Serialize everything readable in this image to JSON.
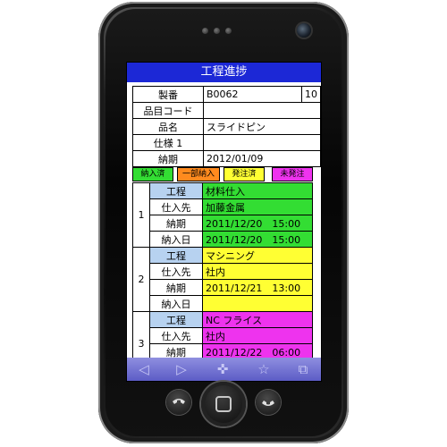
{
  "app": {
    "title": "工程進捗"
  },
  "header": {
    "rows": [
      {
        "label": "製番",
        "value": "B0062",
        "extra": "10"
      },
      {
        "label": "品目コード",
        "value": ""
      },
      {
        "label": "品名",
        "value": "スライドピン"
      },
      {
        "label": "仕様 1",
        "value": ""
      },
      {
        "label": "納期",
        "value": "2012/01/09"
      }
    ]
  },
  "legend": [
    {
      "label": "納入済",
      "color": "#33dd33"
    },
    {
      "label": "一部納入",
      "color": "#ff8a1e"
    },
    {
      "label": "発注済",
      "color": "#ffff33"
    },
    {
      "label": "未発注",
      "color": "#ee33ee"
    }
  ],
  "processes": [
    {
      "index": "1",
      "color": "#33dd33",
      "rows": [
        {
          "label": "工程",
          "value": "材料仕入"
        },
        {
          "label": "仕入先",
          "value": "加藤金属"
        },
        {
          "label": "納期",
          "value": "2011/12/20　15:00"
        },
        {
          "label": "納入日",
          "value": "2011/12/20　15:00"
        }
      ]
    },
    {
      "index": "2",
      "color": "#ffff33",
      "rows": [
        {
          "label": "工程",
          "value": "マシニング"
        },
        {
          "label": "仕入先",
          "value": "社内"
        },
        {
          "label": "納期",
          "value": "2011/12/21　13:00"
        },
        {
          "label": "納入日",
          "value": ""
        }
      ]
    },
    {
      "index": "3",
      "color": "#ee33ee",
      "rows": [
        {
          "label": "工程",
          "value": "NC フライス"
        },
        {
          "label": "仕入先",
          "value": "社内"
        },
        {
          "label": "納期",
          "value": "2011/12/22　06:00"
        }
      ]
    }
  ],
  "navbar": {
    "icons": [
      "back-arrow-icon",
      "forward-arrow-icon",
      "add-icon",
      "star-icon",
      "windows-icon"
    ]
  },
  "hardware": {
    "buttons": [
      "call-button",
      "home-button",
      "end-call-button"
    ]
  }
}
